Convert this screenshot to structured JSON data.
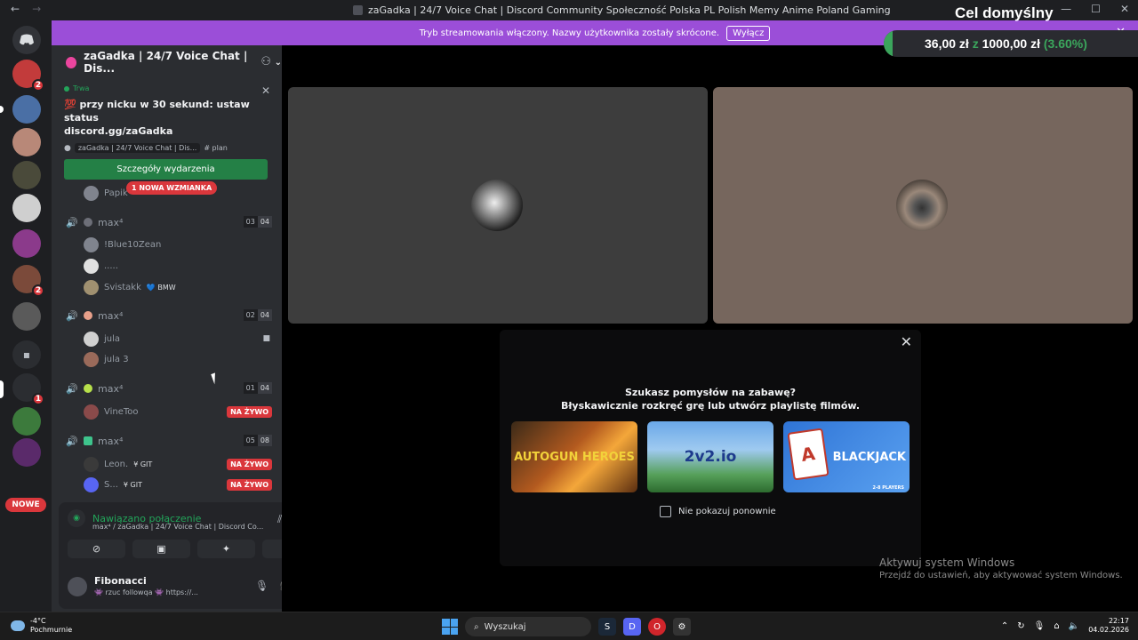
{
  "window": {
    "title": "zaGadka | 24/7 Voice Chat | Discord Community Społeczność Polska PL Polish Memy Anime Poland Gaming",
    "back": "←",
    "forward": "→",
    "minimize": "—",
    "maximize": "☐",
    "close": "✕"
  },
  "goal": {
    "title": "Cel domyślny",
    "current": "36,00 zł",
    "separator": "z",
    "target": "1000,00 zł",
    "percent_text": "(3.60%)",
    "progress": 0.036,
    "color": "#3ba55c"
  },
  "stream_banner": {
    "text": "Tryb streamowania włączony. Nazwy użytkownika zostały skrócone.",
    "button": "Wyłącz",
    "close": "✕"
  },
  "serverbar": {
    "nowe_label": "NOWE",
    "badges": [
      "2",
      "2",
      "1"
    ]
  },
  "server_header": {
    "name": "zaGadka | 24/7 Voice Chat | Dis...",
    "chevron": "⌄"
  },
  "event": {
    "status": "Trwa",
    "title_line1": "💯 przy nicku w 30 sekund: ustaw status",
    "title_line2": "discord.gg/zaGadka",
    "location": "zaGadka | 24/7 Voice Chat | Dis...",
    "channel": "# plan",
    "details_button": "Szczegóły wydarzenia",
    "close": "✕"
  },
  "mention_badge": "1 NOWA WZMIANKA",
  "voice_channels": [
    {
      "name": "max⁴",
      "count_a": "03",
      "count_b": "04",
      "emoji_color": "#6d6f78",
      "users": [
        {
          "name": "!Blue10Zean",
          "tag": "",
          "badge": ""
        },
        {
          "name": ".....",
          "tag": "",
          "badge": ""
        },
        {
          "name": "Svistakk",
          "tag": "💙 BMW",
          "badge": ""
        }
      ]
    },
    {
      "name": "max⁴",
      "count_a": "02",
      "count_b": "04",
      "emoji_color": "#e8a08a",
      "users": [
        {
          "name": "jula",
          "tag": "",
          "badge": "",
          "cam": true
        },
        {
          "name": "jula 3",
          "tag": "",
          "badge": ""
        }
      ]
    },
    {
      "name": "max⁴",
      "count_a": "01",
      "count_b": "04",
      "emoji_color": "#b7e04b",
      "users": [
        {
          "name": "VineToo",
          "tag": "",
          "badge": "NA ŻYWO"
        }
      ]
    },
    {
      "name": "max⁴",
      "count_a": "05",
      "count_b": "08",
      "emoji_color": "#3ec48c",
      "users": [
        {
          "name": "Leon.",
          "tag": "¥ GIT",
          "badge": "NA ŻYWO"
        },
        {
          "name": "S...",
          "tag": "¥ GIT",
          "badge": "NA ŻYWO"
        }
      ]
    }
  ],
  "hidden_user": "Papik",
  "voice_panel": {
    "status": "Nawiązano połączenie",
    "channel": "max⁴ / zaGadka | 24/7 Voice Chat | Discord Co...",
    "user_name": "Fibonacci",
    "user_status": "👾 rzuc followqa 👾 https://..."
  },
  "activity": {
    "heading1": "Szukasz pomysłów na zabawę?",
    "heading2": "Błyskawicznie rozkręć grę lub utwórz playlistę filmów.",
    "games": [
      "AUTOGUN HEROES",
      "2v2.io",
      "BLACKJACK"
    ],
    "blackjack_players": "2-8 PLAYERS",
    "dont_show": "Nie pokazuj ponownie",
    "close": "✕"
  },
  "windows_watermark": {
    "line1": "Aktywuj system Windows",
    "line2": "Przejdź do ustawień, aby aktywować system Windows."
  },
  "taskbar": {
    "temp": "-4°C",
    "weather": "Pochmurnie",
    "search": "Wyszukaj",
    "time": "22:17",
    "date": "04.02.2026"
  }
}
